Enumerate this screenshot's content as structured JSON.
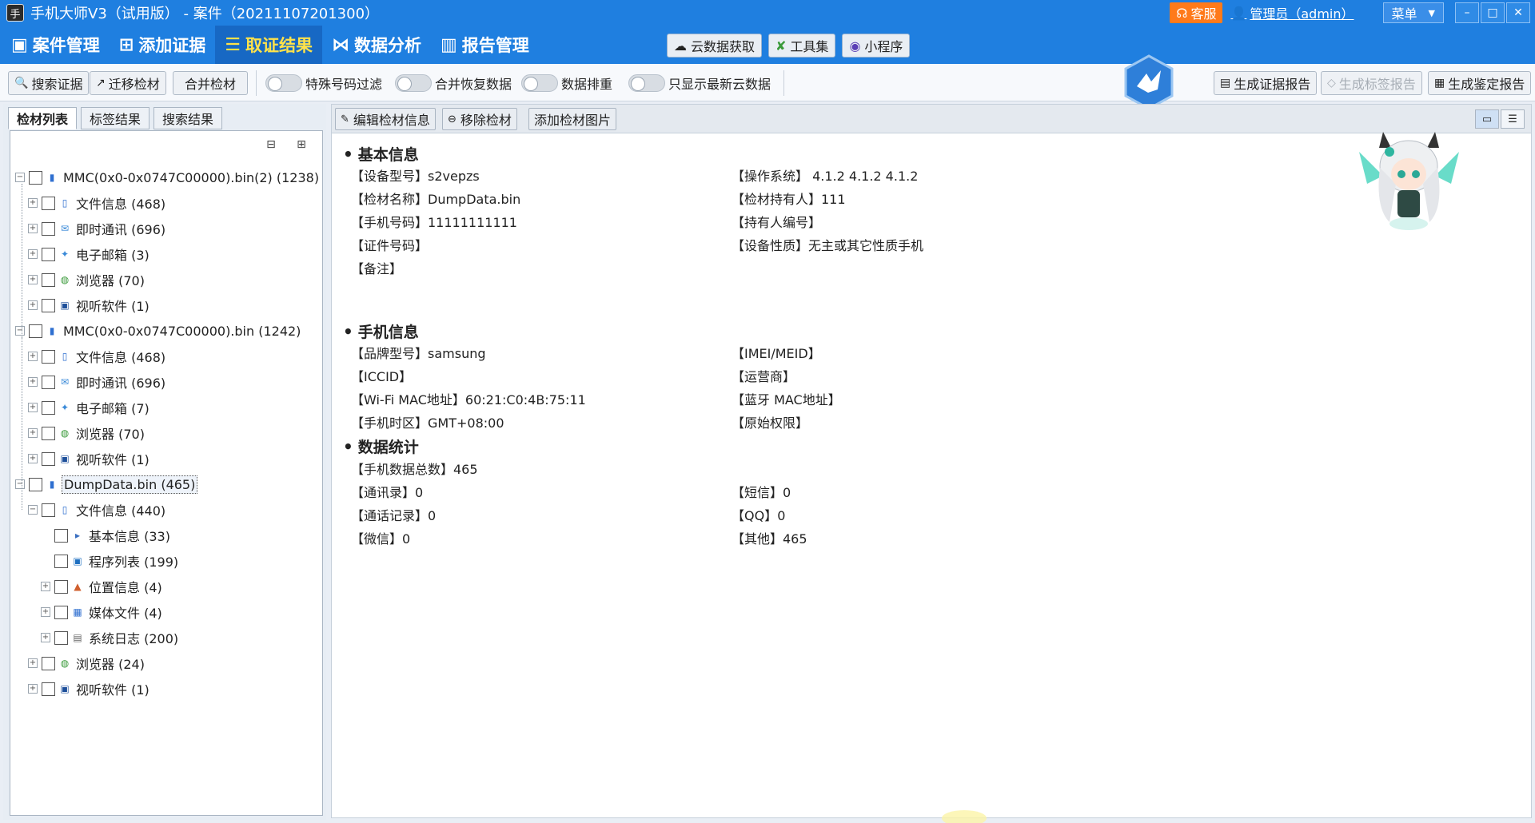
{
  "window": {
    "title": "手机大师V3（试用版） - 案件（20211107201300）",
    "support_label": "客服",
    "user_label": "管理员（admin）",
    "menu_label": "菜单"
  },
  "nav": {
    "items": [
      {
        "label": "案件管理",
        "icon": "case-icon"
      },
      {
        "label": "添加证据",
        "icon": "add-evidence-icon"
      },
      {
        "label": "取证结果",
        "icon": "result-icon"
      },
      {
        "label": "数据分析",
        "icon": "analysis-icon"
      },
      {
        "label": "报告管理",
        "icon": "report-icon"
      }
    ],
    "active_index": 2,
    "tools": [
      {
        "label": "云数据获取",
        "icon": "cloud-icon"
      },
      {
        "label": "工具集",
        "icon": "tools-icon"
      },
      {
        "label": "小程序",
        "icon": "miniapp-icon"
      }
    ]
  },
  "toolbar": {
    "search_evidence": "搜索证据",
    "migrate_material": "迁移检材",
    "merge_material": "合并检材",
    "toggles": [
      {
        "label": "特殊号码过滤",
        "on": false
      },
      {
        "label": "合并恢复数据",
        "on": false
      },
      {
        "label": "数据排重",
        "on": false
      },
      {
        "label": "只显示最新云数据",
        "on": false
      }
    ],
    "gen_evidence_report": "生成证据报告",
    "gen_tag_report": "生成标签报告",
    "gen_appraisal_report": "生成鉴定报告"
  },
  "left_tabs": [
    "检材列表",
    "标签结果",
    "搜索结果"
  ],
  "tree": {
    "nodes": [
      {
        "label": "MMC(0x0-0x0747C00000).bin(2) (1238)",
        "level": 0,
        "exp": "-",
        "icon": "phone-icon"
      },
      {
        "label": "文件信息 (468)",
        "level": 1,
        "exp": "+",
        "icon": "file-info-icon"
      },
      {
        "label": "即时通讯 (696)",
        "level": 1,
        "exp": "+",
        "icon": "im-icon"
      },
      {
        "label": "电子邮箱 (3)",
        "level": 1,
        "exp": "+",
        "icon": "email-icon"
      },
      {
        "label": "浏览器 (70)",
        "level": 1,
        "exp": "+",
        "icon": "browser-icon"
      },
      {
        "label": "视听软件 (1)",
        "level": 1,
        "exp": "+",
        "icon": "media-app-icon"
      },
      {
        "label": "MMC(0x0-0x0747C00000).bin (1242)",
        "level": 0,
        "exp": "-",
        "icon": "phone-icon"
      },
      {
        "label": "文件信息 (468)",
        "level": 1,
        "exp": "+",
        "icon": "file-info-icon"
      },
      {
        "label": "即时通讯 (696)",
        "level": 1,
        "exp": "+",
        "icon": "im-icon"
      },
      {
        "label": "电子邮箱 (7)",
        "level": 1,
        "exp": "+",
        "icon": "email-icon"
      },
      {
        "label": "浏览器 (70)",
        "level": 1,
        "exp": "+",
        "icon": "browser-icon"
      },
      {
        "label": "视听软件 (1)",
        "level": 1,
        "exp": "+",
        "icon": "media-app-icon"
      },
      {
        "label": "DumpData.bin (465)",
        "level": 0,
        "exp": "-",
        "icon": "phone-icon",
        "selected": true
      },
      {
        "label": "文件信息 (440)",
        "level": 1,
        "exp": "-",
        "icon": "file-info-icon"
      },
      {
        "label": "基本信息 (33)",
        "level": 2,
        "exp": "",
        "icon": "basic-info-icon"
      },
      {
        "label": "程序列表 (199)",
        "level": 2,
        "exp": "",
        "icon": "app-list-icon"
      },
      {
        "label": "位置信息 (4)",
        "level": 2,
        "exp": "+",
        "icon": "location-icon"
      },
      {
        "label": "媒体文件 (4)",
        "level": 2,
        "exp": "+",
        "icon": "media-file-icon"
      },
      {
        "label": "系统日志 (200)",
        "level": 2,
        "exp": "+",
        "icon": "syslog-icon"
      },
      {
        "label": "浏览器 (24)",
        "level": 1,
        "exp": "+",
        "icon": "browser-icon"
      },
      {
        "label": "视听软件 (1)",
        "level": 1,
        "exp": "+",
        "icon": "media-app-icon"
      }
    ]
  },
  "right_toolbar": {
    "edit": "编辑检材信息",
    "remove": "移除检材",
    "add_image": "添加检材图片"
  },
  "details": {
    "basic_title": "基本信息",
    "basic_left": [
      "【设备型号】s2vepzs",
      "【检材名称】DumpData.bin",
      "【手机号码】11111111111",
      "【证件号码】",
      "【备注】"
    ],
    "basic_right": [
      "【操作系统】 4.1.2 4.1.2 4.1.2",
      "【检材持有人】111",
      "【持有人编号】",
      "【设备性质】无主或其它性质手机"
    ],
    "phone_title": "手机信息",
    "phone_left": [
      "【品牌型号】samsung",
      "【ICCID】",
      "【Wi-Fi MAC地址】60:21:C0:4B:75:11",
      "【手机时区】GMT+08:00"
    ],
    "phone_right": [
      "【IMEI/MEID】",
      "【运营商】",
      "【蓝牙 MAC地址】",
      "【原始权限】"
    ],
    "stats_title": "数据统计",
    "stats_total": "【手机数据总数】465",
    "stats_left": [
      "【通讯录】0",
      "【通话记录】0",
      "【微信】0"
    ],
    "stats_right": [
      "【短信】0",
      "【QQ】0",
      "【其他】465"
    ]
  }
}
